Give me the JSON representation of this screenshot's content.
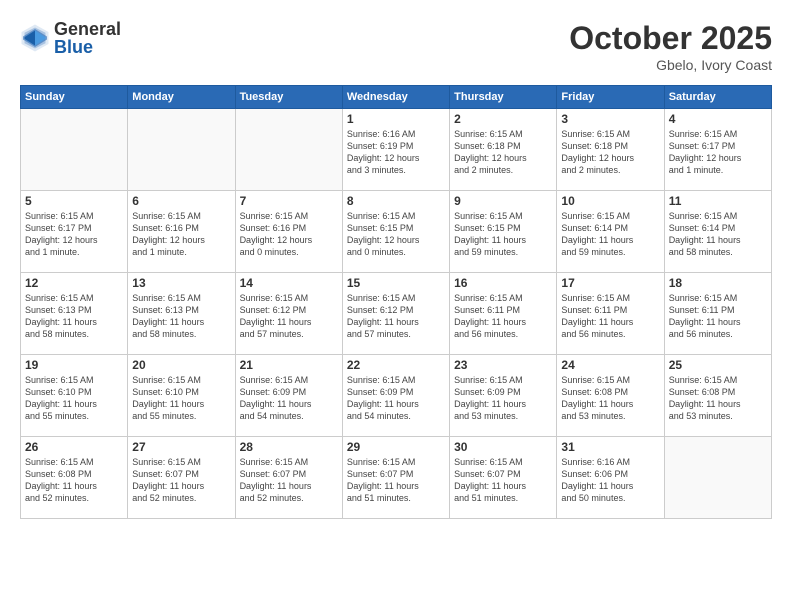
{
  "header": {
    "logo": {
      "general": "General",
      "blue": "Blue"
    },
    "month": "October 2025",
    "location": "Gbelo, Ivory Coast"
  },
  "weekdays": [
    "Sunday",
    "Monday",
    "Tuesday",
    "Wednesday",
    "Thursday",
    "Friday",
    "Saturday"
  ],
  "weeks": [
    [
      {
        "day": "",
        "info": ""
      },
      {
        "day": "",
        "info": ""
      },
      {
        "day": "",
        "info": ""
      },
      {
        "day": "1",
        "info": "Sunrise: 6:16 AM\nSunset: 6:19 PM\nDaylight: 12 hours\nand 3 minutes."
      },
      {
        "day": "2",
        "info": "Sunrise: 6:15 AM\nSunset: 6:18 PM\nDaylight: 12 hours\nand 2 minutes."
      },
      {
        "day": "3",
        "info": "Sunrise: 6:15 AM\nSunset: 6:18 PM\nDaylight: 12 hours\nand 2 minutes."
      },
      {
        "day": "4",
        "info": "Sunrise: 6:15 AM\nSunset: 6:17 PM\nDaylight: 12 hours\nand 1 minute."
      }
    ],
    [
      {
        "day": "5",
        "info": "Sunrise: 6:15 AM\nSunset: 6:17 PM\nDaylight: 12 hours\nand 1 minute."
      },
      {
        "day": "6",
        "info": "Sunrise: 6:15 AM\nSunset: 6:16 PM\nDaylight: 12 hours\nand 1 minute."
      },
      {
        "day": "7",
        "info": "Sunrise: 6:15 AM\nSunset: 6:16 PM\nDaylight: 12 hours\nand 0 minutes."
      },
      {
        "day": "8",
        "info": "Sunrise: 6:15 AM\nSunset: 6:15 PM\nDaylight: 12 hours\nand 0 minutes."
      },
      {
        "day": "9",
        "info": "Sunrise: 6:15 AM\nSunset: 6:15 PM\nDaylight: 11 hours\nand 59 minutes."
      },
      {
        "day": "10",
        "info": "Sunrise: 6:15 AM\nSunset: 6:14 PM\nDaylight: 11 hours\nand 59 minutes."
      },
      {
        "day": "11",
        "info": "Sunrise: 6:15 AM\nSunset: 6:14 PM\nDaylight: 11 hours\nand 58 minutes."
      }
    ],
    [
      {
        "day": "12",
        "info": "Sunrise: 6:15 AM\nSunset: 6:13 PM\nDaylight: 11 hours\nand 58 minutes."
      },
      {
        "day": "13",
        "info": "Sunrise: 6:15 AM\nSunset: 6:13 PM\nDaylight: 11 hours\nand 58 minutes."
      },
      {
        "day": "14",
        "info": "Sunrise: 6:15 AM\nSunset: 6:12 PM\nDaylight: 11 hours\nand 57 minutes."
      },
      {
        "day": "15",
        "info": "Sunrise: 6:15 AM\nSunset: 6:12 PM\nDaylight: 11 hours\nand 57 minutes."
      },
      {
        "day": "16",
        "info": "Sunrise: 6:15 AM\nSunset: 6:11 PM\nDaylight: 11 hours\nand 56 minutes."
      },
      {
        "day": "17",
        "info": "Sunrise: 6:15 AM\nSunset: 6:11 PM\nDaylight: 11 hours\nand 56 minutes."
      },
      {
        "day": "18",
        "info": "Sunrise: 6:15 AM\nSunset: 6:11 PM\nDaylight: 11 hours\nand 56 minutes."
      }
    ],
    [
      {
        "day": "19",
        "info": "Sunrise: 6:15 AM\nSunset: 6:10 PM\nDaylight: 11 hours\nand 55 minutes."
      },
      {
        "day": "20",
        "info": "Sunrise: 6:15 AM\nSunset: 6:10 PM\nDaylight: 11 hours\nand 55 minutes."
      },
      {
        "day": "21",
        "info": "Sunrise: 6:15 AM\nSunset: 6:09 PM\nDaylight: 11 hours\nand 54 minutes."
      },
      {
        "day": "22",
        "info": "Sunrise: 6:15 AM\nSunset: 6:09 PM\nDaylight: 11 hours\nand 54 minutes."
      },
      {
        "day": "23",
        "info": "Sunrise: 6:15 AM\nSunset: 6:09 PM\nDaylight: 11 hours\nand 53 minutes."
      },
      {
        "day": "24",
        "info": "Sunrise: 6:15 AM\nSunset: 6:08 PM\nDaylight: 11 hours\nand 53 minutes."
      },
      {
        "day": "25",
        "info": "Sunrise: 6:15 AM\nSunset: 6:08 PM\nDaylight: 11 hours\nand 53 minutes."
      }
    ],
    [
      {
        "day": "26",
        "info": "Sunrise: 6:15 AM\nSunset: 6:08 PM\nDaylight: 11 hours\nand 52 minutes."
      },
      {
        "day": "27",
        "info": "Sunrise: 6:15 AM\nSunset: 6:07 PM\nDaylight: 11 hours\nand 52 minutes."
      },
      {
        "day": "28",
        "info": "Sunrise: 6:15 AM\nSunset: 6:07 PM\nDaylight: 11 hours\nand 52 minutes."
      },
      {
        "day": "29",
        "info": "Sunrise: 6:15 AM\nSunset: 6:07 PM\nDaylight: 11 hours\nand 51 minutes."
      },
      {
        "day": "30",
        "info": "Sunrise: 6:15 AM\nSunset: 6:07 PM\nDaylight: 11 hours\nand 51 minutes."
      },
      {
        "day": "31",
        "info": "Sunrise: 6:16 AM\nSunset: 6:06 PM\nDaylight: 11 hours\nand 50 minutes."
      },
      {
        "day": "",
        "info": ""
      }
    ]
  ]
}
